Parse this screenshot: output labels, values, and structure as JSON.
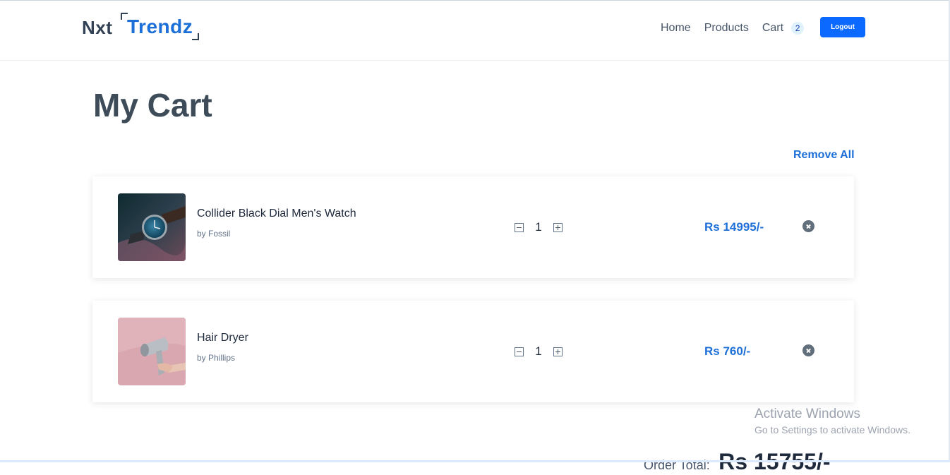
{
  "brand": {
    "part1": "Nxt",
    "part2": "Trendz"
  },
  "nav": {
    "home": "Home",
    "products": "Products",
    "cart": "Cart",
    "cart_count": "2",
    "logout": "Logout"
  },
  "page": {
    "title": "My Cart",
    "remove_all": "Remove All"
  },
  "cart_items": [
    {
      "title": "Collider Black Dial Men's Watch",
      "brand": "by Fossil",
      "quantity": "1",
      "price": "Rs 14995/-"
    },
    {
      "title": "Hair Dryer",
      "brand": "by Phillips",
      "quantity": "1",
      "price": "Rs 760/-"
    }
  ],
  "summary": {
    "label": "Order Total:",
    "amount": "Rs 15755/-"
  },
  "watermark": {
    "title": "Activate Windows",
    "subtitle": "Go to Settings to activate Windows."
  },
  "colors": {
    "accent": "#1d6fd8",
    "button": "#0b69ff",
    "heading": "#3e4c59"
  }
}
